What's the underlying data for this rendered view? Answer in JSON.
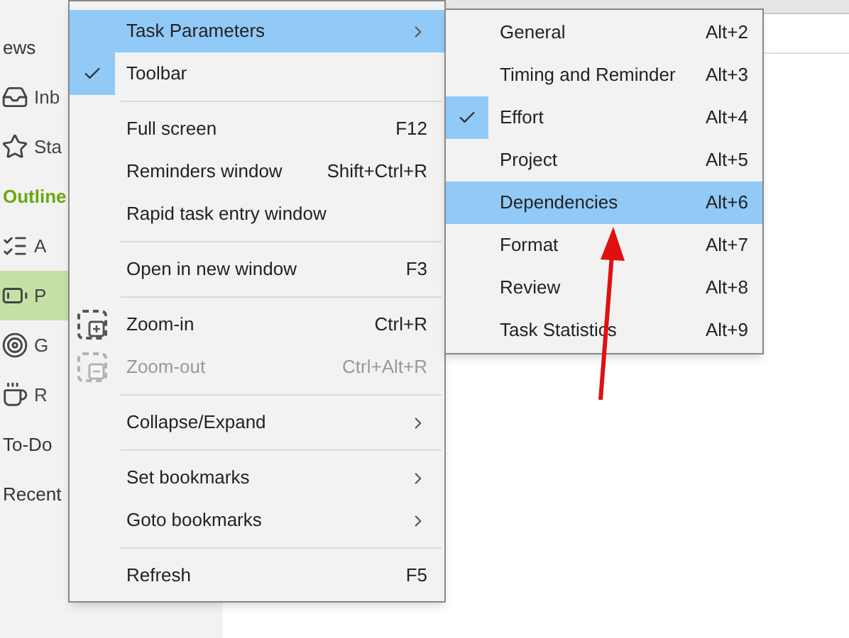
{
  "sidebar": {
    "items": [
      {
        "kind": "header",
        "label": "ews",
        "selected": false
      },
      {
        "kind": "item",
        "label": "Inb",
        "selected": false
      },
      {
        "kind": "item",
        "label": "Sta",
        "selected": false
      },
      {
        "kind": "section",
        "label": "Outline",
        "selected": false
      },
      {
        "kind": "item",
        "label": "A",
        "selected": false
      },
      {
        "kind": "item",
        "label": "P",
        "selected": true
      },
      {
        "kind": "item",
        "label": "G",
        "selected": false
      },
      {
        "kind": "item",
        "label": "R",
        "selected": false
      },
      {
        "kind": "header",
        "label": "To-Do",
        "selected": false
      },
      {
        "kind": "header",
        "label": "Recent",
        "selected": false
      }
    ]
  },
  "menu": {
    "items": [
      {
        "kind": "item",
        "label": "Task Parameters",
        "submenu": true,
        "selected": true,
        "checked": false,
        "disabled": false
      },
      {
        "kind": "item",
        "label": "Toolbar",
        "checked": true,
        "selected": false,
        "disabled": false
      },
      {
        "kind": "separator"
      },
      {
        "kind": "item",
        "label": "Full screen",
        "shortcut": "F12",
        "checked": false,
        "selected": false,
        "disabled": false
      },
      {
        "kind": "item",
        "label": "Reminders window",
        "shortcut": "Shift+Ctrl+R",
        "checked": false,
        "selected": false,
        "disabled": false
      },
      {
        "kind": "item",
        "label": "Rapid task entry window",
        "checked": false,
        "selected": false,
        "disabled": false
      },
      {
        "kind": "separator"
      },
      {
        "kind": "item",
        "label": "Open in new window",
        "shortcut": "F3",
        "checked": false,
        "selected": false,
        "disabled": false
      },
      {
        "kind": "separator"
      },
      {
        "kind": "zoomin",
        "label": "Zoom-in",
        "shortcut": "Ctrl+R",
        "checked": false,
        "selected": false,
        "disabled": false
      },
      {
        "kind": "zoomout",
        "label": "Zoom-out",
        "shortcut": "Ctrl+Alt+R",
        "checked": false,
        "selected": false,
        "disabled": true
      },
      {
        "kind": "separator"
      },
      {
        "kind": "item",
        "label": "Collapse/Expand",
        "submenu": true,
        "checked": false,
        "selected": false,
        "disabled": false
      },
      {
        "kind": "separator"
      },
      {
        "kind": "item",
        "label": "Set bookmarks",
        "submenu": true,
        "checked": false,
        "selected": false,
        "disabled": false
      },
      {
        "kind": "item",
        "label": "Goto bookmarks",
        "submenu": true,
        "checked": false,
        "selected": false,
        "disabled": false
      },
      {
        "kind": "separator"
      },
      {
        "kind": "item",
        "label": "Refresh",
        "shortcut": "F5",
        "checked": false,
        "selected": false,
        "disabled": false
      }
    ]
  },
  "submenu": {
    "items": [
      {
        "label": "General",
        "shortcut": "Alt+2",
        "checked": false,
        "selected": false
      },
      {
        "label": "Timing and Reminder",
        "shortcut": "Alt+3",
        "checked": false,
        "selected": false
      },
      {
        "label": "Effort",
        "shortcut": "Alt+4",
        "checked": true,
        "selected": false
      },
      {
        "label": "Project",
        "shortcut": "Alt+5",
        "checked": false,
        "selected": false
      },
      {
        "label": "Dependencies",
        "shortcut": "Alt+6",
        "checked": false,
        "selected": true
      },
      {
        "label": "Format",
        "shortcut": "Alt+7",
        "checked": false,
        "selected": false
      },
      {
        "label": "Review",
        "shortcut": "Alt+8",
        "checked": false,
        "selected": false
      },
      {
        "label": "Task Statistics",
        "shortcut": "Alt+9",
        "checked": false,
        "selected": false
      }
    ]
  }
}
